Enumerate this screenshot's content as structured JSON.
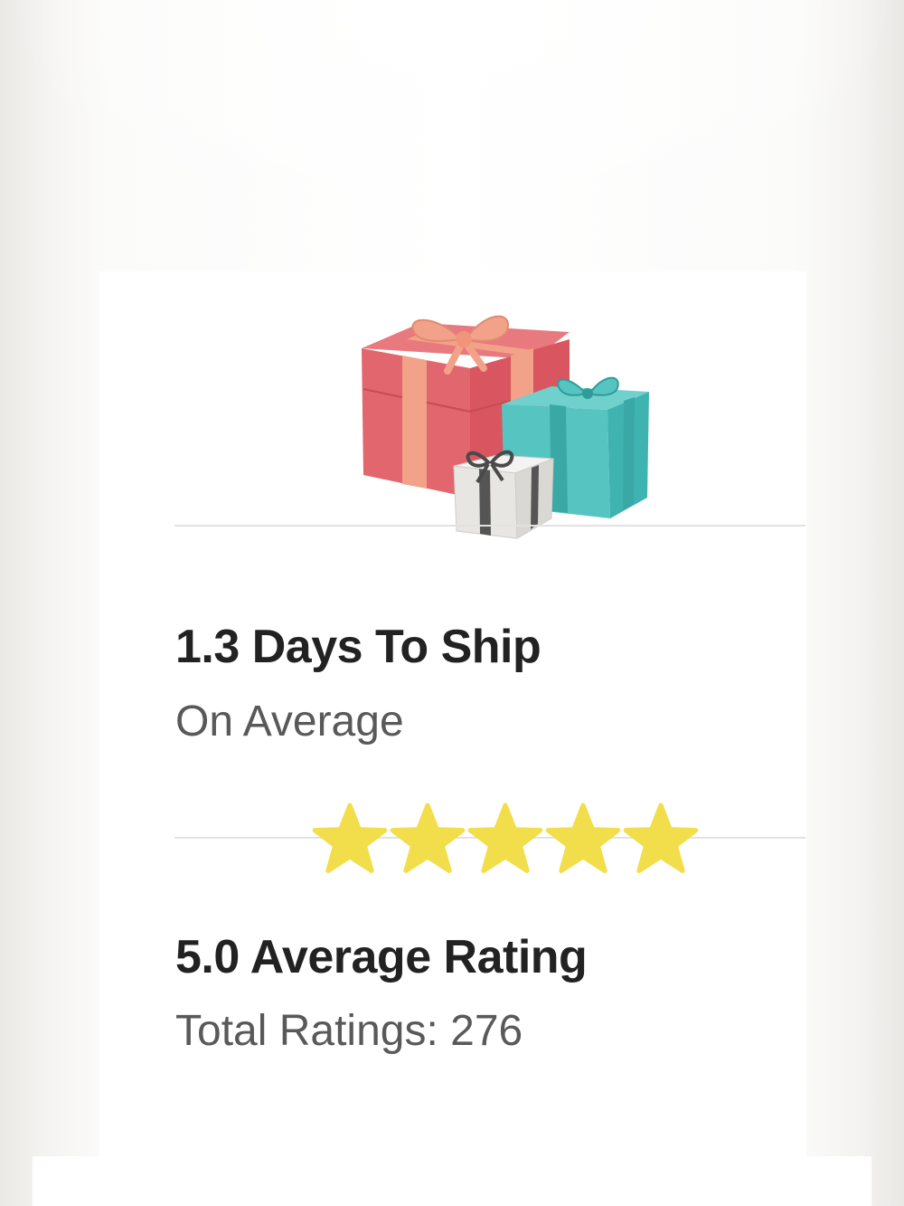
{
  "shipping": {
    "title": "1.3 Days To Ship",
    "subtitle": "On Average"
  },
  "rating": {
    "title": "5.0 Average Rating",
    "subtitle": "Total Ratings: 276",
    "stars_filled": 5,
    "stars_total": 5,
    "star_color": "#f2dd4a"
  },
  "illustration": {
    "icons": [
      "gift-box-red-icon",
      "gift-box-teal-icon",
      "gift-box-white-icon"
    ],
    "colors": {
      "red": "#e2666d",
      "ribbon": "#f3a28a",
      "teal": "#56c5c1",
      "gray": "#e8e6e3",
      "dark_ribbon": "#555555"
    }
  }
}
